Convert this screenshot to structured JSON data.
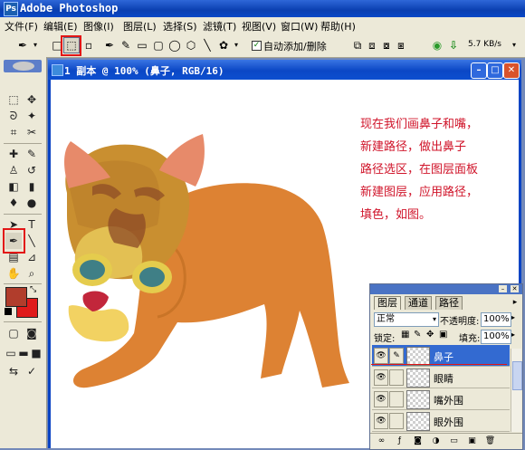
{
  "app": {
    "title": "Adobe Photoshop",
    "logo_text": "Ps"
  },
  "menu": [
    "文件(F)",
    "编辑(E)",
    "图像(I)",
    "图层(L)",
    "选择(S)",
    "滤镜(T)",
    "视图(V)",
    "窗口(W)",
    "帮助(H)"
  ],
  "options": {
    "auto_add_delete_label": "自动添加/删除",
    "auto_add_delete_checked": true,
    "speed": "5.7 KB/s"
  },
  "document": {
    "title": "1 副本 @ 100% (鼻子, RGB/16)"
  },
  "note_lines": [
    "现在我们画鼻子和嘴，",
    "新建路径，做出鼻子",
    "路径选区，在图层面板",
    "新建图层，应用路径，",
    "填色，如图。"
  ],
  "layers": {
    "tabs": [
      "图层",
      "通道",
      "路径"
    ],
    "blend_mode": "正常",
    "opacity_label": "不透明度:",
    "opacity": "100%",
    "lock_label": "锁定:",
    "fill_label": "填充:",
    "fill": "100%",
    "items": [
      "鼻子",
      "眼睛",
      "嘴外围",
      "眼外围"
    ]
  },
  "colors": {
    "foreground": "#b13d2c",
    "background": "#e01a1a",
    "highlight_red": "#e21616",
    "note_text": "#d0142a",
    "dog_body": "#dd8233",
    "dog_head": "#c98f30"
  }
}
